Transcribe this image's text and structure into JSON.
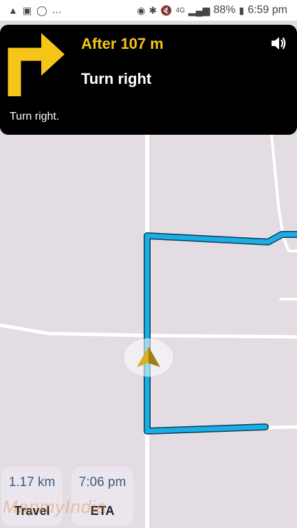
{
  "status_bar": {
    "left_icons": [
      "navigation-icon",
      "image-icon",
      "circle-icon"
    ],
    "more": "...",
    "right_icons": [
      "location-icon",
      "bluetooth-icon",
      "mute-icon",
      "signal-icon"
    ],
    "network": "4G",
    "battery": "88%",
    "time": "6:59 pm"
  },
  "navigation": {
    "distance": "After 107 m",
    "instruction": "Turn right",
    "voice_text": "Turn right.",
    "arrow_icon": "turn-right-arrow-icon",
    "arrow_color": "#f5c518"
  },
  "colors": {
    "route": "#1aaee5",
    "map_background": "#e3dce3",
    "road": "#ffffff"
  },
  "trip": {
    "distance_value": "1.17 km",
    "distance_label": "Travel",
    "eta_value": "7:06 pm",
    "eta_label": "ETA"
  },
  "watermark": "MapmyIndia"
}
